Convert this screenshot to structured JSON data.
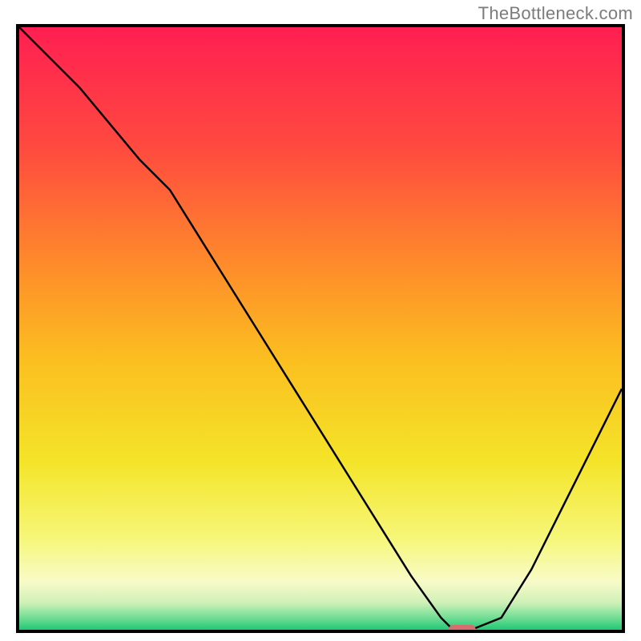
{
  "watermark": "TheBottleneck.com",
  "chart_data": {
    "type": "line",
    "title": "",
    "xlabel": "",
    "ylabel": "",
    "xlim": [
      0,
      100
    ],
    "ylim": [
      0,
      100
    ],
    "grid": false,
    "legend": false,
    "x": [
      0,
      5,
      10,
      15,
      20,
      25,
      30,
      35,
      40,
      45,
      50,
      55,
      60,
      65,
      70,
      72,
      75,
      80,
      85,
      90,
      95,
      100
    ],
    "y": [
      100,
      95,
      90,
      84,
      78,
      73,
      65,
      57,
      49,
      41,
      33,
      25,
      17,
      9,
      2,
      0,
      0,
      2,
      10,
      20,
      30,
      40
    ],
    "marker": {
      "x": 73.5,
      "y": 0,
      "color": "#d96d6d",
      "shape": "pill"
    },
    "background_gradient": {
      "type": "vertical",
      "stops": [
        {
          "pos": 0.0,
          "color": "#ff1f52"
        },
        {
          "pos": 0.2,
          "color": "#ff4a3f"
        },
        {
          "pos": 0.4,
          "color": "#fe8d2a"
        },
        {
          "pos": 0.55,
          "color": "#fbbe20"
        },
        {
          "pos": 0.72,
          "color": "#f4e428"
        },
        {
          "pos": 0.85,
          "color": "#f6f77a"
        },
        {
          "pos": 0.92,
          "color": "#f8fbc8"
        },
        {
          "pos": 0.955,
          "color": "#d0f0b8"
        },
        {
          "pos": 0.975,
          "color": "#84e29c"
        },
        {
          "pos": 1.0,
          "color": "#23c875"
        }
      ]
    },
    "frame_color": "#000000",
    "curve_color": "#000000"
  }
}
